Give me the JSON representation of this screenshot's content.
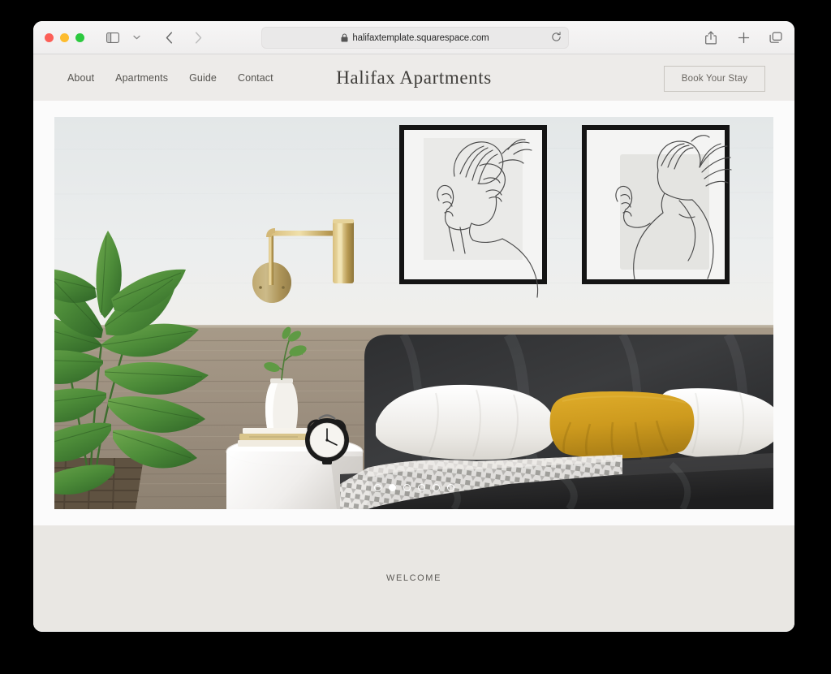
{
  "browser": {
    "traffic_lights": [
      "close",
      "minimize",
      "maximize"
    ],
    "sidebar_toggle": "sidebar-icon",
    "tab_overview_chevron": "chevron-down-icon",
    "back_label": "Back",
    "forward_label": "Forward",
    "address": {
      "secure_icon": "lock-icon",
      "url": "halifaxtemplate.squarespace.com",
      "reload_icon": "reload-icon"
    },
    "actions": {
      "share": "share-icon",
      "new_tab": "plus-icon",
      "tabs": "tabs-icon"
    }
  },
  "site": {
    "title": "Halifax Apartments",
    "nav": [
      {
        "label": "About"
      },
      {
        "label": "Apartments"
      },
      {
        "label": "Guide"
      },
      {
        "label": "Contact"
      }
    ],
    "cta": {
      "label": "Book Your Stay"
    },
    "hero": {
      "alt": "Modern bedroom with dark velvet bed, mustard pillow, line-art prints and a large leafy plant",
      "carousel": {
        "total": 6,
        "active_index": 2
      },
      "elements": {
        "wall_sconce": "brass-wall-sconce",
        "artwork_left": "line-art-print-left",
        "artwork_right": "line-art-print-right",
        "plant": "leafy-plant",
        "nightstand": "round-nightstand",
        "alarm_clock": "alarm-clock",
        "vase": "vase-with-sprig",
        "books": "stacked-books",
        "accent_pillow": "mustard-accent-pillow"
      }
    },
    "welcome": {
      "label": "WELCOME"
    },
    "colors": {
      "header_bg": "#edebe9",
      "page_bg": "#fbfbfb",
      "welcome_bg": "#e9e7e3",
      "text": "#55534f",
      "accent_pillow": "#d39f23",
      "brass": "#c0a062"
    }
  }
}
